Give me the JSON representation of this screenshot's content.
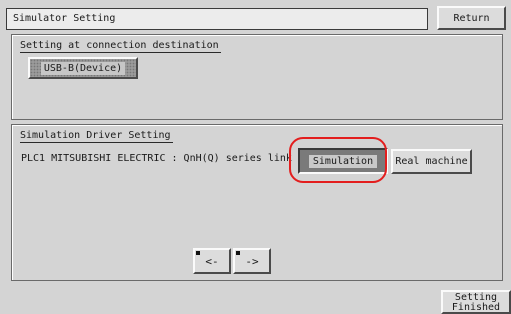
{
  "header": {
    "title": "Simulator Setting",
    "return_label": "Return"
  },
  "connection_panel": {
    "title": "Setting at connection destination",
    "device_button": "USB-B(Device)"
  },
  "simulation_panel": {
    "title": "Simulation Driver Setting",
    "plc_line": "PLC1  MITSUBISHI ELECTRIC : QnH(Q) series link",
    "simulation_label": "Simulation",
    "real_machine_label": "Real machine",
    "prev_label": "<-",
    "next_label": "->"
  },
  "footer": {
    "finish_line1": "Setting",
    "finish_line2": "Finished"
  },
  "colors": {
    "highlight": "#e31e1e",
    "background": "#d4d4d4"
  }
}
